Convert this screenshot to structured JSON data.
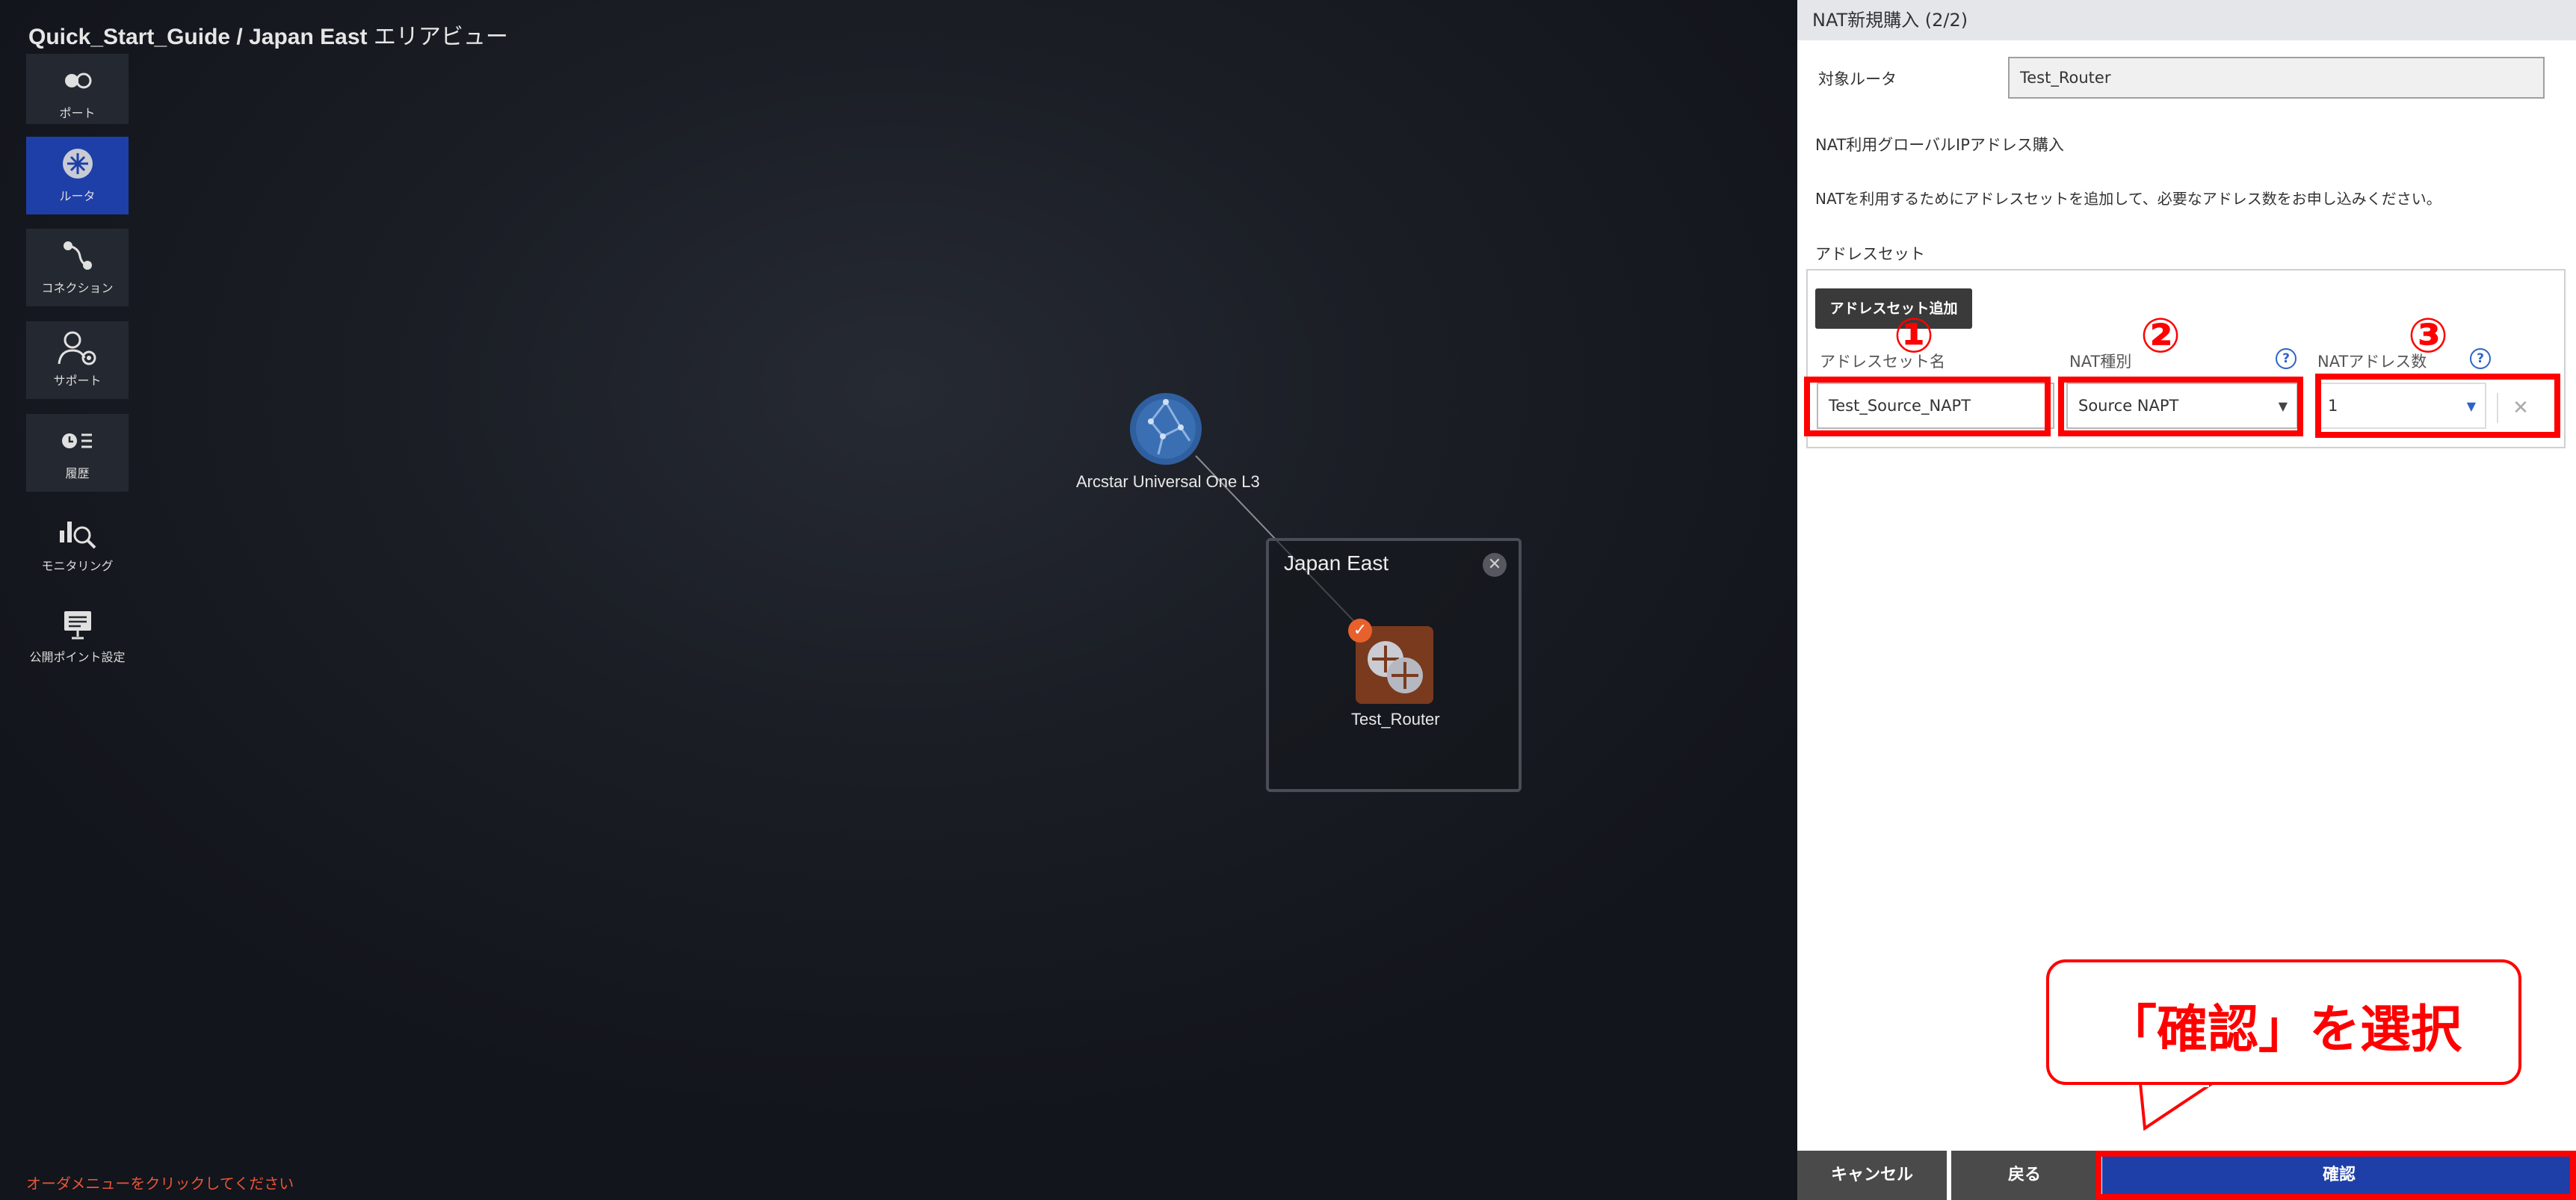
{
  "breadcrumb": {
    "path": "Quick_Start_Guide / Japan East",
    "view": " エリアビュー"
  },
  "sidebar": {
    "items": [
      {
        "label": "ポート",
        "icon": "port-icon"
      },
      {
        "label": "ルータ",
        "icon": "router-icon",
        "active": true
      },
      {
        "label": "コネクション",
        "icon": "connection-icon"
      },
      {
        "label": "サポート",
        "icon": "support-icon"
      },
      {
        "label": "履歴",
        "icon": "history-icon"
      },
      {
        "label": "モニタリング",
        "icon": "monitoring-icon"
      },
      {
        "label": "公開ポイント設定",
        "icon": "public-point-icon"
      }
    ]
  },
  "canvas": {
    "network_node": "Arcstar Universal One L3",
    "region_title": "Japan East",
    "router_name": "Test_Router",
    "footer_message": "オーダメニューをクリックしてください"
  },
  "panel": {
    "title": "NAT新規購入 (2/2)",
    "target_router_label": "対象ルータ",
    "target_router_value": "Test_Router",
    "global_ip_heading": "NAT利用グローバルIPアドレス購入",
    "instruction": "NATを利用するためにアドレスセットを追加して、必要なアドレス数をお申し込みください。",
    "address_set_heading": "アドレスセット",
    "add_address_set_button": "アドレスセット追加",
    "columns": {
      "name": "アドレスセット名",
      "nat_type": "NAT種別",
      "nat_address_count": "NATアドレス数"
    },
    "row": {
      "name": "Test_Source_NAPT",
      "nat_type": "Source NAPT",
      "nat_address_count": "1"
    },
    "buttons": {
      "cancel": "キャンセル",
      "back": "戻る",
      "confirm": "確認"
    }
  },
  "annotations": {
    "marker_1": "①",
    "marker_2": "②",
    "marker_3": "③",
    "callout": "「確認」を選択"
  },
  "colors": {
    "accent_blue": "#1e3fa8",
    "router_orange": "#7a3a1e",
    "annotation_red": "#ff0000",
    "warning_orange": "#e8553a"
  }
}
